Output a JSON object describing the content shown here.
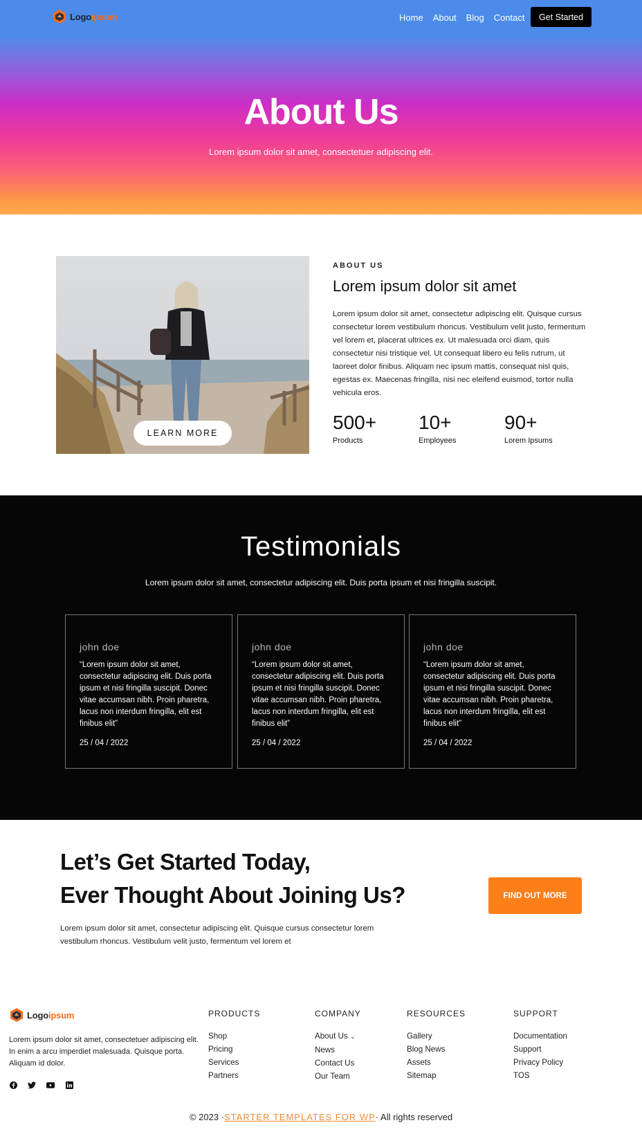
{
  "header": {
    "logo": {
      "part1": "Logo",
      "part2": "ipsum"
    },
    "nav": [
      "Home",
      "About",
      "Blog",
      "Contact"
    ],
    "cta_label": "Get Started"
  },
  "hero": {
    "title": "About Us",
    "subtitle": "Lorem ipsum dolor sit amet, consectetuer adipiscing elit."
  },
  "about": {
    "button_label": "LEARN MORE",
    "eyebrow": "ABOUT US",
    "title": "Lorem ipsum dolor sit amet",
    "body": "Lorem ipsum dolor sit amet, consectetur adipiscing elit. Quisque cursus consectetur lorem vestibulum rhoncus. Vestibulum velit justo, fermentum vel lorem et, placerat ultrices ex. Ut malesuada orci diam, quis consectetur nisi tristique vel. Ut consequat libero eu felis rutrum, ut laoreet dolor finibus. Aliquam nec ipsum mattis, consequat nisl quis, egestas ex. Maecenas fringilla, nisi nec eleifend euismod, tortor nulla vehicula eros.",
    "stats": [
      {
        "value": "500+",
        "label": "Products"
      },
      {
        "value": "10+",
        "label": "Employees"
      },
      {
        "value": "90+",
        "label": "Lorem Ipsums"
      }
    ]
  },
  "testimonials": {
    "title": "Testimonials",
    "subtitle": "Lorem ipsum dolor sit amet, consectetur adipiscing elit. Duis porta ipsum et nisi fringilla suscipit.",
    "cards": [
      {
        "name": "john doe",
        "quote": "“Lorem ipsum dolor sit amet, consectetur adipiscing elit. Duis porta ipsum et nisi fringilla suscipit. Donec vitae accumsan nibh. Proin pharetra, lacus non interdum fringilla, elit est finibus elit”",
        "date": "25 / 04 / 2022"
      },
      {
        "name": "john doe",
        "quote": "“Lorem ipsum dolor sit amet, consectetur adipiscing elit. Duis porta ipsum et nisi fringilla suscipit. Donec vitae accumsan nibh. Proin pharetra, lacus non interdum fringilla, elit est finibus elit”",
        "date": "25 / 04 / 2022"
      },
      {
        "name": "john doe",
        "quote": "“Lorem ipsum dolor sit amet, consectetur adipiscing elit. Duis porta ipsum et nisi fringilla suscipit. Donec vitae accumsan nibh. Proin pharetra, lacus non interdum fringilla, elit est finibus elit”",
        "date": "25 / 04 / 2022"
      }
    ]
  },
  "cta": {
    "title_line1": "Let’s Get Started Today,",
    "title_line2": "Ever Thought About Joining Us?",
    "body": "Lorem ipsum dolor sit amet, consectetur adipiscing elit. Quisque cursus consectetur lorem vestibulum rhoncus. Vestibulum velit justo, fermentum vel lorem et",
    "button_label": "FIND OUT MORE"
  },
  "footer": {
    "logo": {
      "part1": "Logo",
      "part2": "ipsum"
    },
    "description": "Lorem ipsum dolor sit amet, consectetuer adipiscing elit. In enim a arcu imperdiet malesuada. Quisque porta. Aliquam id dolor.",
    "socials": [
      "facebook-icon",
      "twitter-icon",
      "youtube-icon",
      "linkedin-icon"
    ],
    "columns": [
      {
        "heading": "PRODUCTS",
        "items": [
          "Shop",
          "Pricing",
          "Services",
          "Partners"
        ]
      },
      {
        "heading": "COMPANY",
        "items": [
          "About Us",
          "News",
          "Contact Us",
          "Our Team"
        ]
      },
      {
        "heading": "RESOURCES",
        "items": [
          "Gallery",
          "Blog News",
          "Assets",
          "Sitemap"
        ]
      },
      {
        "heading": "SUPPORT",
        "items": [
          "Documentation",
          "Support",
          "Privacy Policy",
          "TOS"
        ]
      }
    ],
    "copyright_prefix": "© 2023 ·",
    "copyright_link": "STARTER TEMPLATES FOR WP",
    "copyright_suffix": "· All rights reserved"
  },
  "colors": {
    "accent_orange": "#fd7f1a",
    "hero_top": "#4c8bea",
    "hero_mid": "#cc2dc6",
    "hero_bottom": "#ffa94c",
    "dark_bg": "#060606"
  }
}
